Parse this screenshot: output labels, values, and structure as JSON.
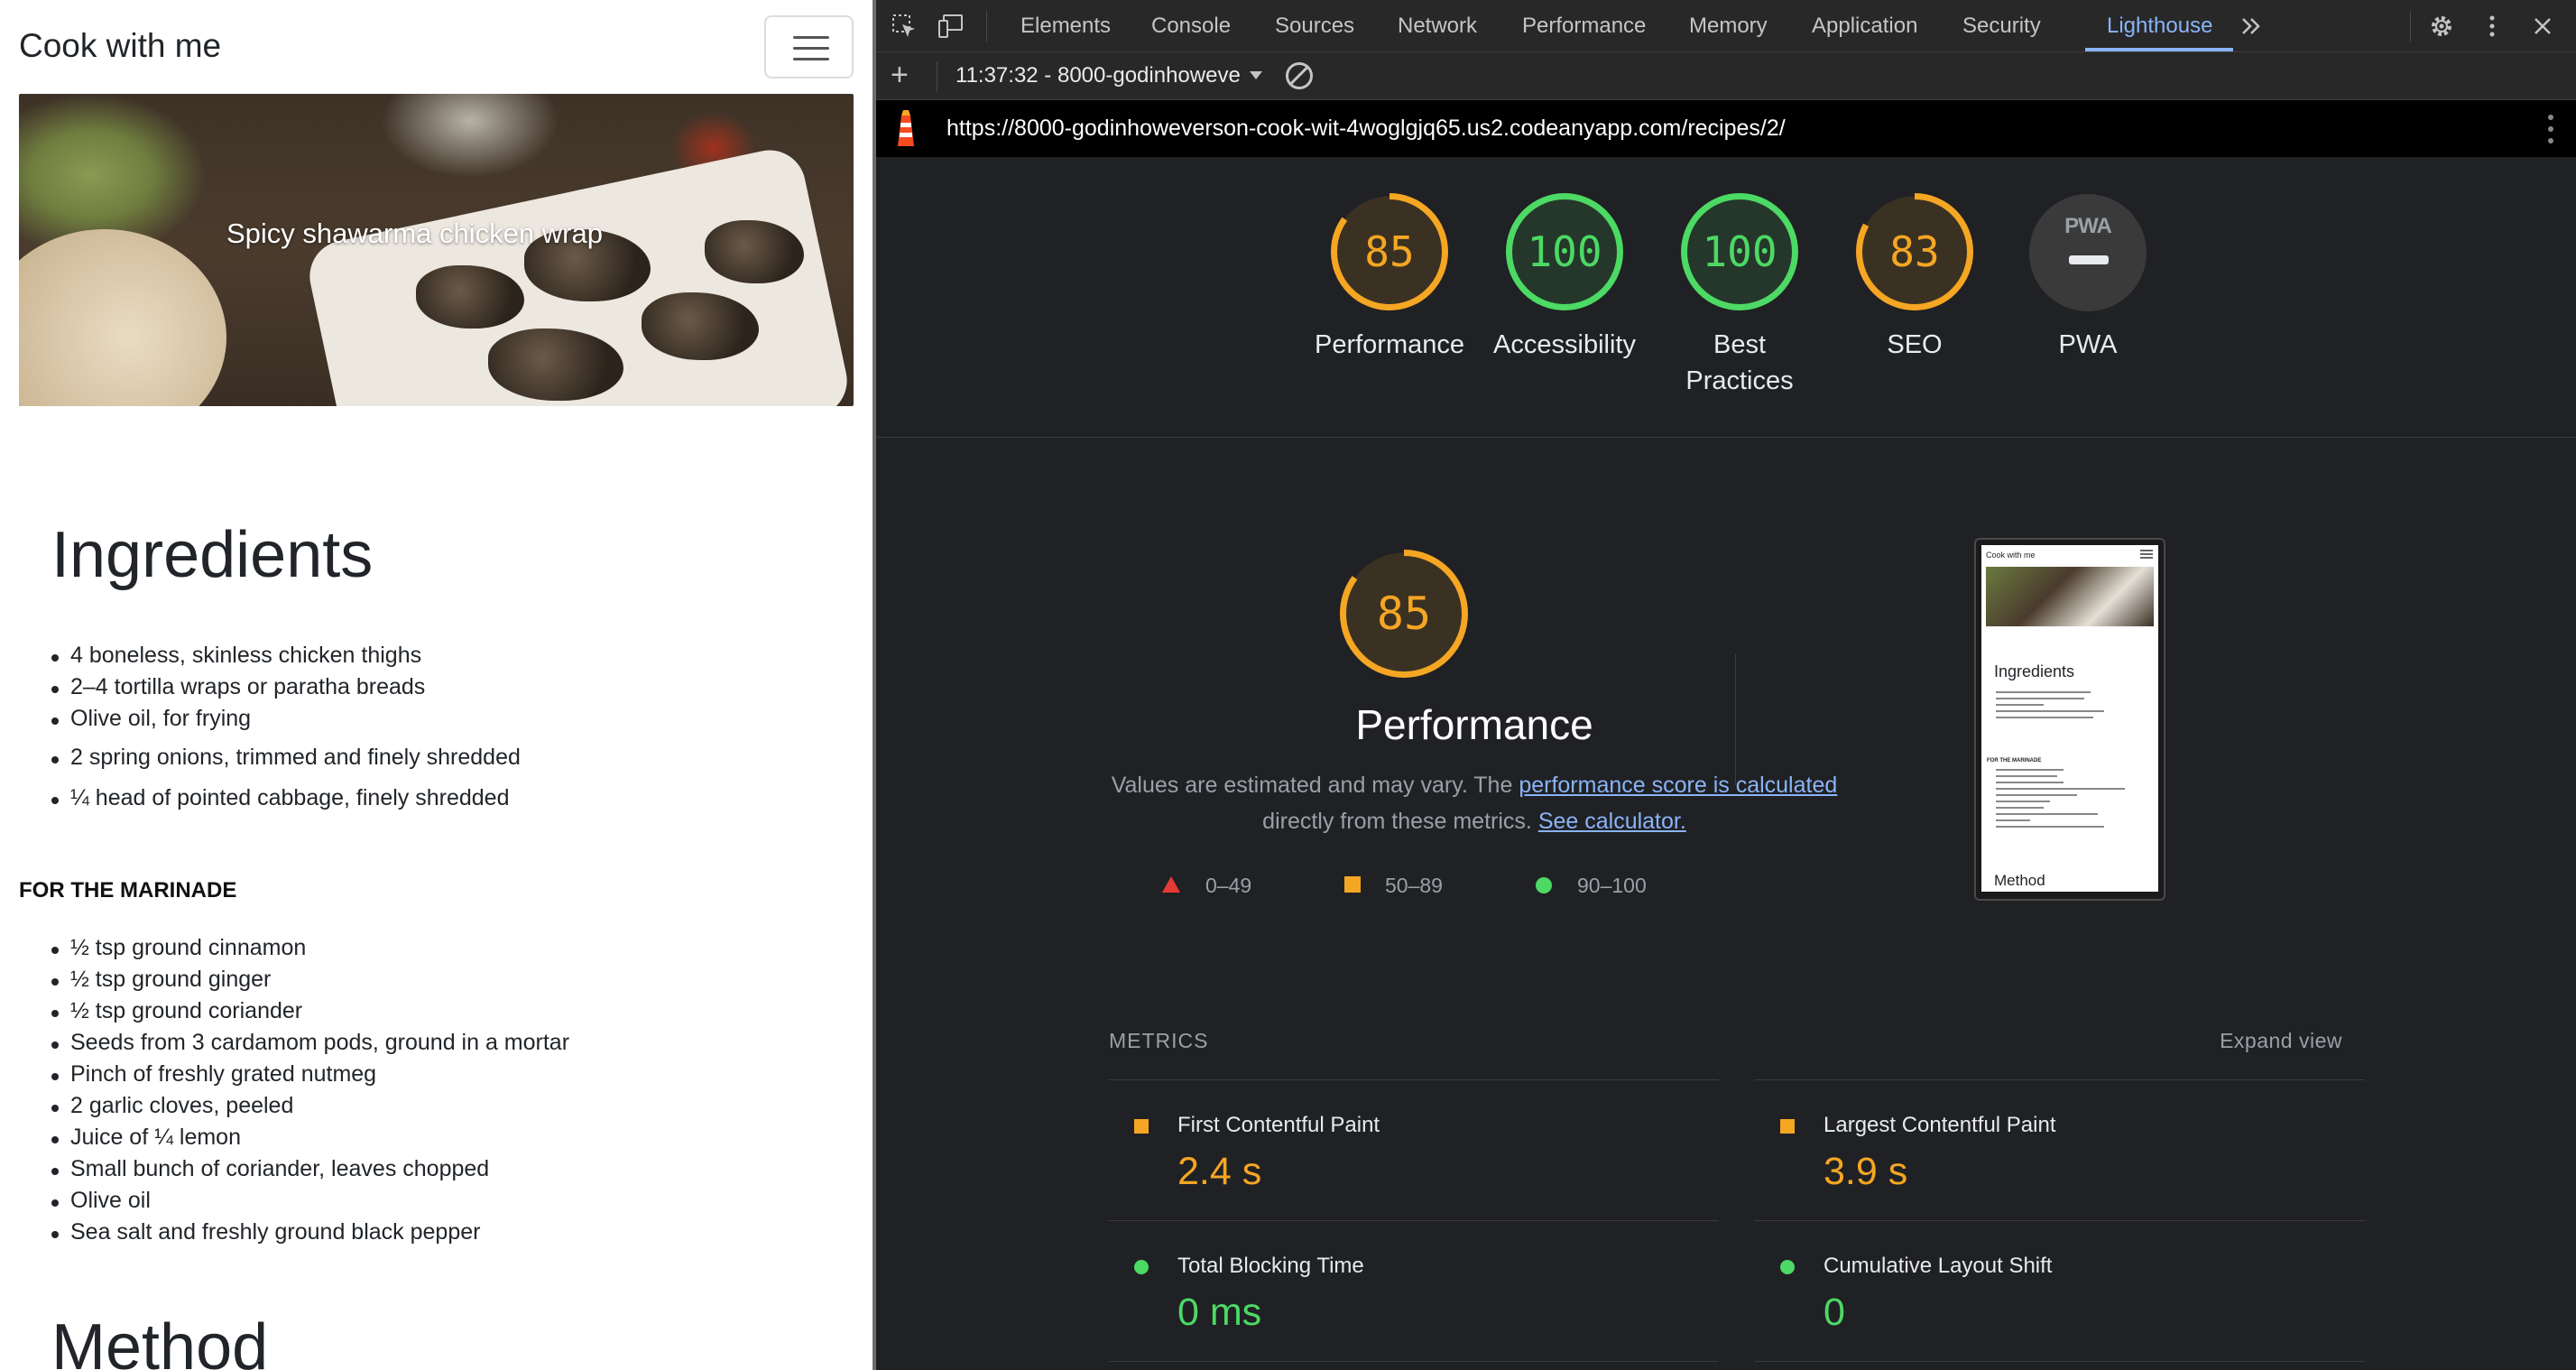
{
  "site": {
    "brand": "Cook with me",
    "hero_caption": "Spicy shawarma chicken wrap",
    "ingredients_heading": "Ingredients",
    "ingredients": [
      "4 boneless, skinless chicken thighs",
      "2–4 tortilla wraps or paratha breads",
      "Olive oil, for frying",
      "2 spring onions, trimmed and finely shredded",
      "¼ head of pointed cabbage, finely shredded"
    ],
    "marinade_heading": "FOR THE MARINADE",
    "marinade": [
      "½ tsp ground cinnamon",
      "½ tsp ground ginger",
      "½ tsp ground coriander",
      "Seeds from 3 cardamom pods, ground in a mortar",
      "Pinch of freshly grated nutmeg",
      "2 garlic cloves, peeled",
      "Juice of ¼ lemon",
      "Small bunch of coriander, leaves chopped",
      "Olive oil",
      "Sea salt and freshly ground black pepper"
    ],
    "method_heading": "Method"
  },
  "devtools": {
    "tabs": [
      "Elements",
      "Console",
      "Sources",
      "Network",
      "Performance",
      "Memory",
      "Application",
      "Security",
      "Lighthouse"
    ],
    "active_tab": "Lighthouse",
    "more_tabs_icon": "chevron-double-right-icon",
    "report_label": "11:37:32 - 8000-godinhoweve",
    "url": "https://8000-godinhoweverson-cook-wit-4woglgjq65.us2.codeanyapp.com/recipes/2/",
    "scores": [
      {
        "label": "Performance",
        "value": "85",
        "fraction": 0.85,
        "color": "#f5a623"
      },
      {
        "label": "Accessibility",
        "value": "100",
        "fraction": 1.0,
        "color": "#4cd964"
      },
      {
        "label": "Best Practices",
        "value": "100",
        "fraction": 1.0,
        "color": "#4cd964"
      },
      {
        "label": "SEO",
        "value": "83",
        "fraction": 0.83,
        "color": "#f5a623"
      }
    ],
    "pwa": {
      "label": "PWA",
      "badge": "PWA"
    },
    "perf": {
      "score": "85",
      "fraction": 0.85,
      "title": "Performance",
      "desc_pre": "Values are estimated and may vary. The ",
      "desc_link": "performance score is calculated",
      "desc_mid": " directly from these metrics. ",
      "desc_calc": "See calculator.",
      "legend": [
        {
          "range": "0–49",
          "shape": "triangle",
          "color": "#e53935"
        },
        {
          "range": "50–89",
          "shape": "square",
          "color": "#f5a623"
        },
        {
          "range": "90–100",
          "shape": "circle",
          "color": "#4cd964"
        }
      ]
    },
    "thumb": {
      "brand": "Cook with me",
      "heading": "Ingredients",
      "sub": "FOR THE MARINADE",
      "method": "Method"
    },
    "metrics_heading": "METRICS",
    "expand_label": "Expand view",
    "metrics": [
      {
        "label": "First Contentful Paint",
        "value": "2.4 s",
        "status": "average",
        "color": "#f5a623"
      },
      {
        "label": "Largest Contentful Paint",
        "value": "3.9 s",
        "status": "average",
        "color": "#f5a623"
      },
      {
        "label": "Total Blocking Time",
        "value": "0 ms",
        "status": "pass",
        "color": "#4cd964"
      },
      {
        "label": "Cumulative Layout Shift",
        "value": "0",
        "status": "pass",
        "color": "#4cd964"
      }
    ]
  }
}
